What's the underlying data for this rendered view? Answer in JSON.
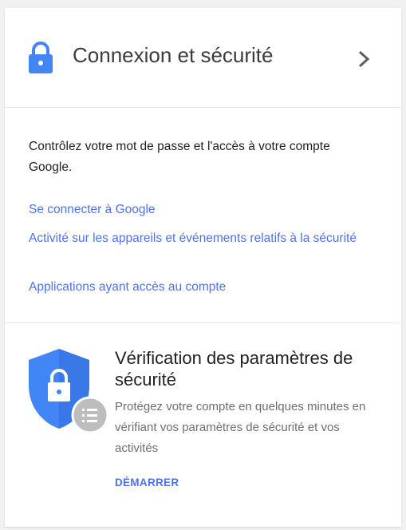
{
  "header": {
    "title": "Connexion et sécurité",
    "lock_icon": "lock-icon",
    "chevron_icon": "chevron-right-icon"
  },
  "section": {
    "description": "Contrôlez votre mot de passe et l'accès à votre compte Google.",
    "links": [
      "Se connecter à Google",
      "Activité sur les appareils et événements relatifs à la sécurité",
      "Applications ayant accès au compte"
    ]
  },
  "security_check": {
    "title": "Vérification des paramètres de sécurité",
    "description": "Protégez votre compte en quelques minutes en vérifiant vos paramètres de sécurité et vos activités",
    "button_label": "DÉMARRER",
    "shield_icon": "shield-lock-icon",
    "list_badge_icon": "list-icon"
  },
  "colors": {
    "accent": "#4e73e9",
    "shield": "#4285f4",
    "badge": "#bdbdbd",
    "title_text": "#3c3c3c",
    "body_text": "#212121",
    "secondary_text": "#6e6e6e"
  }
}
